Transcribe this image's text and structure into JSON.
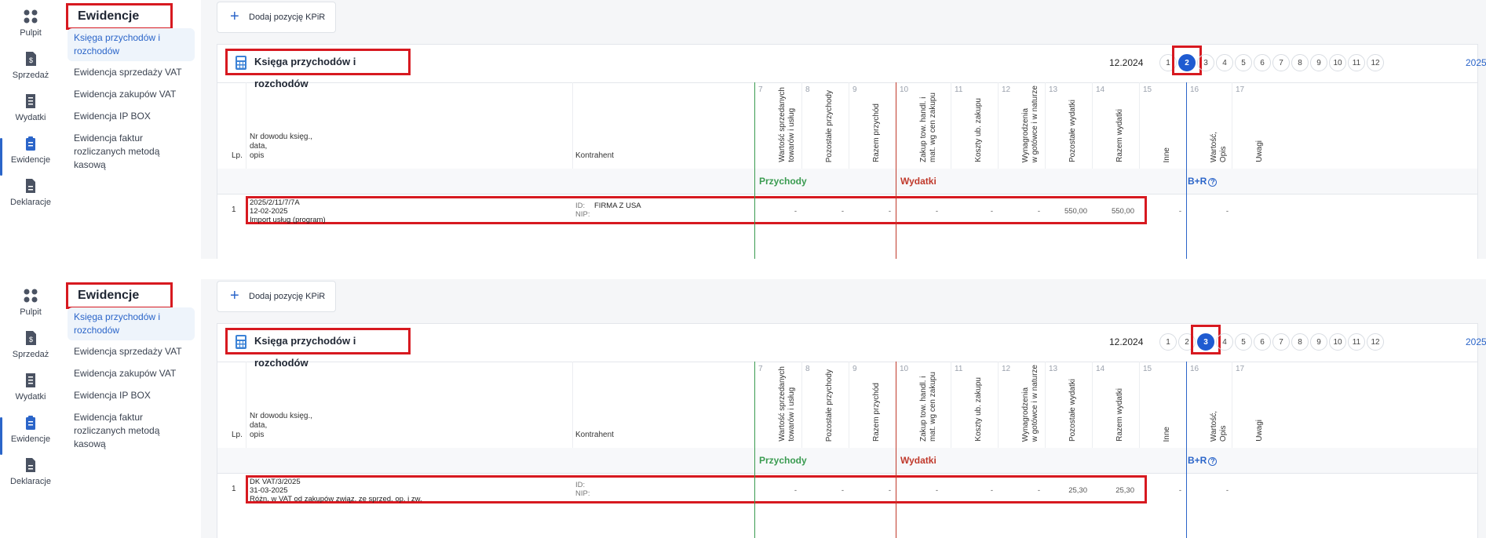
{
  "rail": [
    {
      "label": "Pulpit",
      "icon": "dashboard-icon"
    },
    {
      "label": "Sprzedaż",
      "icon": "invoice-dollar-icon"
    },
    {
      "label": "Wydatki",
      "icon": "receipt-icon"
    },
    {
      "label": "Ewidencje",
      "icon": "clipboard-icon"
    },
    {
      "label": "Deklaracje",
      "icon": "document-icon"
    }
  ],
  "sidebar": {
    "title": "Ewidencje",
    "items": [
      {
        "label": "Księga przychodów i rozchodów"
      },
      {
        "label": "Ewidencja sprzedaży VAT"
      },
      {
        "label": "Ewidencja zakupów VAT"
      },
      {
        "label": "Ewidencja IP BOX"
      },
      {
        "label": "Ewidencja faktur rozliczanych metodą kasową"
      }
    ]
  },
  "toolbar": {
    "add_label": "Dodaj pozycję KPiR"
  },
  "card": {
    "title": "Księga przychodów i rozchodów",
    "period": "12.2024",
    "months": [
      "1",
      "2",
      "3",
      "4",
      "5",
      "6",
      "7",
      "8",
      "9",
      "10",
      "11",
      "12"
    ],
    "year": "2025"
  },
  "columns": {
    "lp": "Lp.",
    "doc": "Nr dowodu księg.,\ndata,\nopis",
    "kontrahent": "Kontrahent",
    "numbers": [
      "7",
      "8",
      "9",
      "10",
      "11",
      "12",
      "13",
      "14",
      "15",
      "16",
      "17"
    ],
    "c7": "Wartość sprzedanych\ntowarów i usług",
    "c8": "Pozostałe przychody",
    "c9": "Razem przychód",
    "c10": "Zakup tow. handl. i\nmat. wg cen zakupu",
    "c11": "Koszty ub. zakupu",
    "c12": "Wynagrodzenia\nw gotówce i w naturze",
    "c13": "Pozostałe wydatki",
    "c14": "Razem wydatki",
    "c15": "Inne",
    "c16": "Wartość,\nOpis",
    "c17": "Uwagi"
  },
  "sections": {
    "przychody": "Przychody",
    "wydatki": "Wydatki",
    "br": "B+R",
    "br_help": "?"
  },
  "panels": [
    {
      "active_month": "2",
      "row": {
        "lp": "1",
        "doc": "2025/2/11/7/7A\n12-02-2025\nImport usług (program)",
        "id_label": "ID:",
        "id_value": "FIRMA Z USA",
        "nip_label": "NIP:",
        "nip_value": "",
        "c7": "-",
        "c8": "-",
        "c9": "-",
        "c10": "-",
        "c11": "-",
        "c12": "-",
        "c13": "550,00",
        "c14": "550,00",
        "c15": "-",
        "c16": "-"
      }
    },
    {
      "active_month": "3",
      "row": {
        "lp": "1",
        "doc": "DK VAT/3/2025\n31-03-2025\nRóżn. w VAT od zakupów związ. ze sprzed. op. i zw.",
        "id_label": "ID:",
        "id_value": "",
        "nip_label": "NIP:",
        "nip_value": "",
        "c7": "-",
        "c8": "-",
        "c9": "-",
        "c10": "-",
        "c11": "-",
        "c12": "-",
        "c13": "25,30",
        "c14": "25,30",
        "c15": "-",
        "c16": "-"
      }
    }
  ]
}
